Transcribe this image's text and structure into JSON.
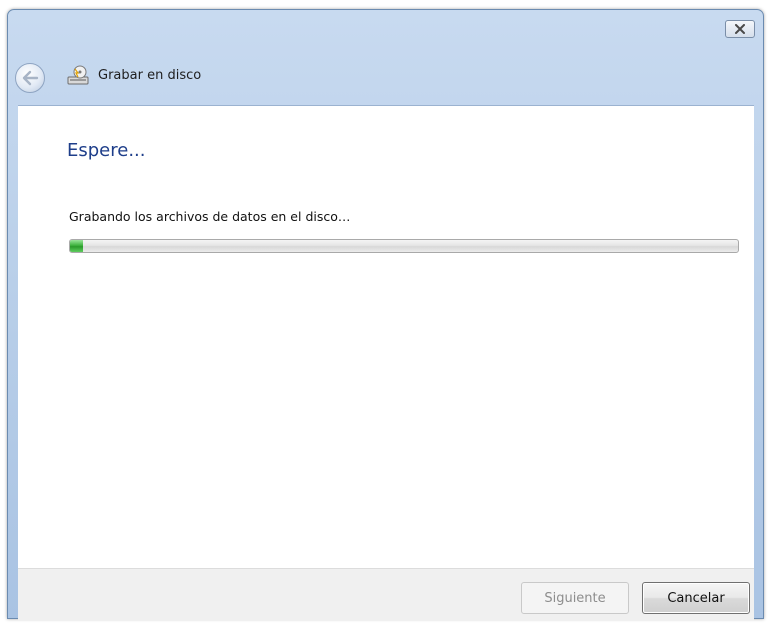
{
  "window": {
    "title": "Grabar en disco",
    "title_icon": "burn-disc-icon",
    "back_icon": "back-arrow-icon",
    "close_icon": "close-icon"
  },
  "main": {
    "heading": "Espere...",
    "status_text": "Grabando los archivos de datos en el disco…",
    "progress_fraction": 0.02
  },
  "footer": {
    "next_label": "Siguiente",
    "cancel_label": "Cancelar"
  },
  "colors": {
    "heading": "#1e3e8a",
    "progress_fill": "#3fb33f",
    "title_bar": "#b9cfe9"
  }
}
